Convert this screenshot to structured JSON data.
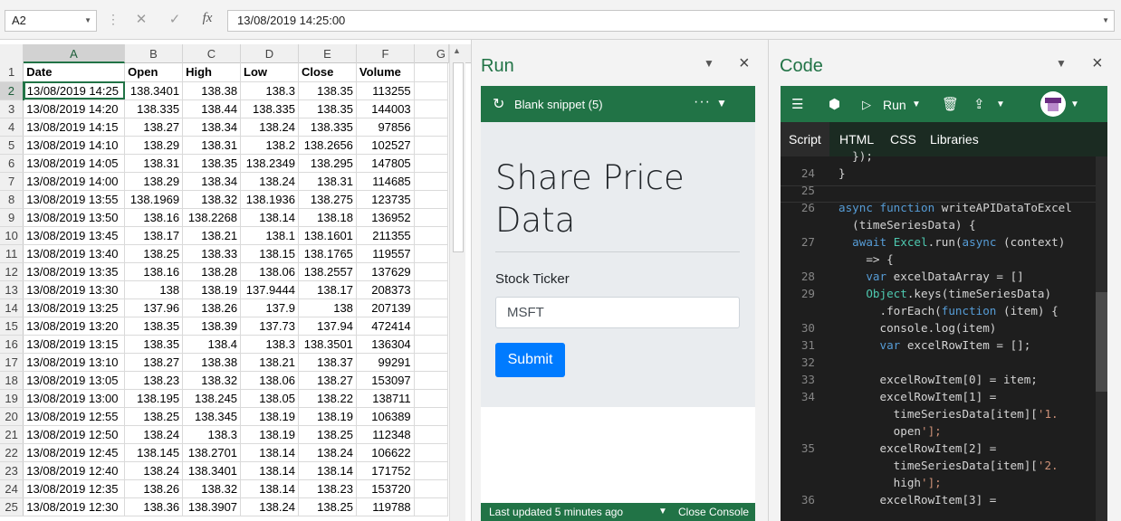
{
  "formula_bar": {
    "name_box": "A2",
    "cancel_icon": "✕",
    "enter_icon": "✓",
    "fx_label": "fx",
    "formula": "13/08/2019  14:25:00"
  },
  "sheet": {
    "columns": [
      "A",
      "B",
      "C",
      "D",
      "E",
      "F",
      "G"
    ],
    "header_row": {
      "row": "1",
      "cells": [
        "Date",
        "Open",
        "High",
        "Low",
        "Close",
        "Volume"
      ]
    },
    "rows": [
      {
        "row": "2",
        "cells": [
          "13/08/2019 14:25",
          "138.3401",
          "138.38",
          "138.3",
          "138.35",
          "113255"
        ]
      },
      {
        "row": "3",
        "cells": [
          "13/08/2019 14:20",
          "138.335",
          "138.44",
          "138.335",
          "138.35",
          "144003"
        ]
      },
      {
        "row": "4",
        "cells": [
          "13/08/2019 14:15",
          "138.27",
          "138.34",
          "138.24",
          "138.335",
          "97856"
        ]
      },
      {
        "row": "5",
        "cells": [
          "13/08/2019 14:10",
          "138.29",
          "138.31",
          "138.2",
          "138.2656",
          "102527"
        ]
      },
      {
        "row": "6",
        "cells": [
          "13/08/2019 14:05",
          "138.31",
          "138.35",
          "138.2349",
          "138.295",
          "147805"
        ]
      },
      {
        "row": "7",
        "cells": [
          "13/08/2019 14:00",
          "138.29",
          "138.34",
          "138.24",
          "138.31",
          "114685"
        ]
      },
      {
        "row": "8",
        "cells": [
          "13/08/2019 13:55",
          "138.1969",
          "138.32",
          "138.1936",
          "138.275",
          "123735"
        ]
      },
      {
        "row": "9",
        "cells": [
          "13/08/2019 13:50",
          "138.16",
          "138.2268",
          "138.14",
          "138.18",
          "136952"
        ]
      },
      {
        "row": "10",
        "cells": [
          "13/08/2019 13:45",
          "138.17",
          "138.21",
          "138.1",
          "138.1601",
          "211355"
        ]
      },
      {
        "row": "11",
        "cells": [
          "13/08/2019 13:40",
          "138.25",
          "138.33",
          "138.15",
          "138.1765",
          "119557"
        ]
      },
      {
        "row": "12",
        "cells": [
          "13/08/2019 13:35",
          "138.16",
          "138.28",
          "138.06",
          "138.2557",
          "137629"
        ]
      },
      {
        "row": "13",
        "cells": [
          "13/08/2019 13:30",
          "138",
          "138.19",
          "137.9444",
          "138.17",
          "208373"
        ]
      },
      {
        "row": "14",
        "cells": [
          "13/08/2019 13:25",
          "137.96",
          "138.26",
          "137.9",
          "138",
          "207139"
        ]
      },
      {
        "row": "15",
        "cells": [
          "13/08/2019 13:20",
          "138.35",
          "138.39",
          "137.73",
          "137.94",
          "472414"
        ]
      },
      {
        "row": "16",
        "cells": [
          "13/08/2019 13:15",
          "138.35",
          "138.4",
          "138.3",
          "138.3501",
          "136304"
        ]
      },
      {
        "row": "17",
        "cells": [
          "13/08/2019 13:10",
          "138.27",
          "138.38",
          "138.21",
          "138.37",
          "99291"
        ]
      },
      {
        "row": "18",
        "cells": [
          "13/08/2019 13:05",
          "138.23",
          "138.32",
          "138.06",
          "138.27",
          "153097"
        ]
      },
      {
        "row": "19",
        "cells": [
          "13/08/2019 13:00",
          "138.195",
          "138.245",
          "138.05",
          "138.22",
          "138711"
        ]
      },
      {
        "row": "20",
        "cells": [
          "13/08/2019 12:55",
          "138.25",
          "138.345",
          "138.19",
          "138.19",
          "106389"
        ]
      },
      {
        "row": "21",
        "cells": [
          "13/08/2019 12:50",
          "138.24",
          "138.3",
          "138.19",
          "138.25",
          "112348"
        ]
      },
      {
        "row": "22",
        "cells": [
          "13/08/2019 12:45",
          "138.145",
          "138.2701",
          "138.14",
          "138.24",
          "106622"
        ]
      },
      {
        "row": "23",
        "cells": [
          "13/08/2019 12:40",
          "138.24",
          "138.3401",
          "138.14",
          "138.14",
          "171752"
        ]
      },
      {
        "row": "24",
        "cells": [
          "13/08/2019 12:35",
          "138.26",
          "138.32",
          "138.14",
          "138.23",
          "153720"
        ]
      },
      {
        "row": "25",
        "cells": [
          "13/08/2019 12:30",
          "138.36",
          "138.3907",
          "138.24",
          "138.25",
          "119788"
        ]
      }
    ]
  },
  "run_pane": {
    "title": "Run",
    "snippet_name": "Blank snippet (5)",
    "more_label": "···",
    "heading": "Share Price Data",
    "ticker_label": "Stock Ticker",
    "ticker_value": "MSFT",
    "submit_label": "Submit",
    "status_text": "Last updated 5 minutes ago",
    "console_label": "Close Console"
  },
  "code_pane": {
    "title": "Code",
    "run_label": "Run",
    "tabs": [
      "Script",
      "HTML",
      "CSS",
      "Libraries"
    ],
    "active_tab": "Script",
    "partial_line": "  });",
    "lines": [
      {
        "no": "24",
        "text": "}"
      },
      {
        "no": "25",
        "text": ""
      },
      {
        "no": "26",
        "text": "async function writeAPIDataToExcel"
      },
      {
        "no": "",
        "text": "  (timeSeriesData) {"
      },
      {
        "no": "27",
        "text": "  await Excel.run(async (context)"
      },
      {
        "no": "",
        "text": "    => {"
      },
      {
        "no": "28",
        "text": "    var excelDataArray = []"
      },
      {
        "no": "29",
        "text": "    Object.keys(timeSeriesData)"
      },
      {
        "no": "",
        "text": "      .forEach(function (item) {"
      },
      {
        "no": "30",
        "text": "      console.log(item)"
      },
      {
        "no": "31",
        "text": "      var excelRowItem = [];"
      },
      {
        "no": "32",
        "text": ""
      },
      {
        "no": "33",
        "text": "      excelRowItem[0] = item;"
      },
      {
        "no": "34",
        "text": "      excelRowItem[1] ="
      },
      {
        "no": "",
        "text": "        timeSeriesData[item]['1."
      },
      {
        "no": "",
        "text": "        open'];"
      },
      {
        "no": "35",
        "text": "      excelRowItem[2] ="
      },
      {
        "no": "",
        "text": "        timeSeriesData[item]['2."
      },
      {
        "no": "",
        "text": "        high'];"
      },
      {
        "no": "36",
        "text": "      excelRowItem[3] ="
      }
    ]
  },
  "colors": {
    "excel_green": "#217346",
    "submit_blue": "#007bff",
    "code_bg": "#1e1e1e"
  }
}
